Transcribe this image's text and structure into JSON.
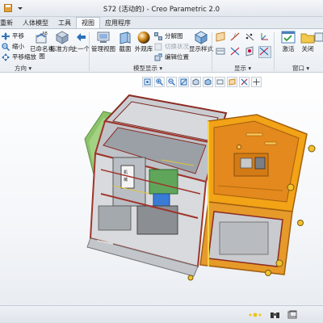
{
  "window": {
    "title": "S72 (活动的) - Creo Parametric 2.0"
  },
  "tabs": [
    {
      "label": "重新"
    },
    {
      "label": "人体模型"
    },
    {
      "label": "工具"
    },
    {
      "label": "视图"
    },
    {
      "label": "应用程序"
    }
  ],
  "active_tab": "视图",
  "ribbon": {
    "pan": "平移",
    "zoom_out": "缩小",
    "pan_zoom": "平移缩放",
    "saved_views": "已命名视图",
    "standard_orientation": "标准方向",
    "previous": "上一个",
    "manage_views": "管理视图",
    "section": "截面",
    "appearance": "外观库",
    "exploded_view": "分解图",
    "toggle_status": "切换状况",
    "edit_position": "编辑位置",
    "display_style": "显示样式",
    "activate": "激活",
    "close": "关闭"
  },
  "groups": {
    "orientation": "方向",
    "model_display": "模型显示",
    "show": "显示",
    "window": "窗口"
  },
  "colors": {
    "accent": "#f2a316",
    "housing_orange": "#e4891d",
    "frame_red": "#b0352b",
    "green_part": "#8cc26a"
  }
}
